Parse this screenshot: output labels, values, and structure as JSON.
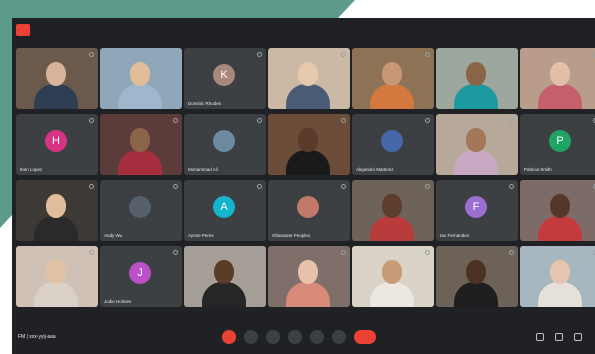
{
  "meeting": {
    "time_and_code": "FM | xxx-yyij-aaa",
    "participants": [
      {
        "name": "",
        "type": "video",
        "bg": "#6b5a4b",
        "skin": "#d9b39a",
        "shirt": "#2f3e52"
      },
      {
        "name": "",
        "type": "video",
        "bg": "#8fa7b9",
        "skin": "#e1bd97",
        "shirt": "#9fb7cc"
      },
      {
        "name": "Dominic Rhodes",
        "type": "letter",
        "letter": "K",
        "color": "#a9877a"
      },
      {
        "name": "",
        "type": "video",
        "bg": "#cbb8a5",
        "skin": "#e7c9b0",
        "shirt": "#4a5c75"
      },
      {
        "name": "",
        "type": "video",
        "bg": "#8d7256",
        "skin": "#c89775",
        "shirt": "#d4793e"
      },
      {
        "name": "",
        "type": "video",
        "bg": "#9ea79d",
        "skin": "#8a6547",
        "shirt": "#1d9aa0"
      },
      {
        "name": "",
        "type": "video",
        "bg": "#b79d8a",
        "skin": "#e1bfa8",
        "shirt": "#c55f6b"
      },
      {
        "name": "Iben Lopez",
        "type": "letter",
        "letter": "H",
        "color": "#d63384"
      },
      {
        "name": "",
        "type": "video",
        "bg": "#5b3c3a",
        "skin": "#8c6449",
        "shirt": "#a62f3f"
      },
      {
        "name": "Muhammad Ali",
        "type": "photo",
        "color": "#6d8ba0"
      },
      {
        "name": "",
        "type": "video",
        "bg": "#6b4c39",
        "skin": "#5a3a28",
        "shirt": "#1a1a1a"
      },
      {
        "name": "Alejandro Martinez",
        "type": "photo",
        "color": "#4768a8"
      },
      {
        "name": "",
        "type": "video",
        "bg": "#b7a99a",
        "skin": "#a37858",
        "shirt": "#c9a8c4"
      },
      {
        "name": "Patricia Smith",
        "type": "letter",
        "letter": "P",
        "color": "#1fa463"
      },
      {
        "name": "",
        "type": "video",
        "bg": "#3d3a36",
        "skin": "#e0be9c",
        "shirt": "#2a2a2a"
      },
      {
        "name": "Andy Wu",
        "type": "photo",
        "color": "#55606b"
      },
      {
        "name": "Aynne Peres",
        "type": "letter",
        "letter": "A",
        "color": "#12b5cb"
      },
      {
        "name": "Ghassane Peoples",
        "type": "photo",
        "color": "#c17a6a"
      },
      {
        "name": "",
        "type": "video",
        "bg": "#6e6358",
        "skin": "#5d3e2d",
        "shirt": "#b83c3c"
      },
      {
        "name": "Ian Fernandes",
        "type": "letter",
        "letter": "F",
        "color": "#9a6fd1"
      },
      {
        "name": "",
        "type": "video",
        "bg": "#7c6b66",
        "skin": "#55382a",
        "shirt": "#c33b3b"
      },
      {
        "name": "",
        "type": "video",
        "bg": "#cfc1b5",
        "skin": "#e3c2a3",
        "shirt": "#d9d0c8"
      },
      {
        "name": "Jodie Holmes",
        "type": "letter",
        "letter": "J",
        "color": "#bb50c8"
      },
      {
        "name": "",
        "type": "video",
        "bg": "#a49e96",
        "skin": "#5a3c2a",
        "shirt": "#262626"
      },
      {
        "name": "",
        "type": "video",
        "bg": "#7f6e69",
        "skin": "#e7c3aa",
        "shirt": "#d88a79"
      },
      {
        "name": "",
        "type": "video",
        "bg": "#d9d2c7",
        "skin": "#c89b7a",
        "shirt": "#ece8e1"
      },
      {
        "name": "",
        "type": "video",
        "bg": "#6d6257",
        "skin": "#4c3222",
        "shirt": "#1f1f1f"
      },
      {
        "name": "",
        "type": "video",
        "bg": "#a8b6c0",
        "skin": "#e5c5ad",
        "shirt": "#e6e0da"
      }
    ]
  },
  "colors": {
    "frame_green": "#5c9a8b",
    "meet_dark": "#202124",
    "tile_gray": "#3c4043",
    "end_call_red": "#ea4335"
  },
  "controls": {
    "icons": [
      "mic-icon",
      "camera-icon",
      "captions-icon",
      "raise-hand-icon",
      "present-icon",
      "more-icon",
      "end-call-icon"
    ],
    "right_icons": [
      "info-icon",
      "people-icon",
      "activities-icon"
    ]
  }
}
